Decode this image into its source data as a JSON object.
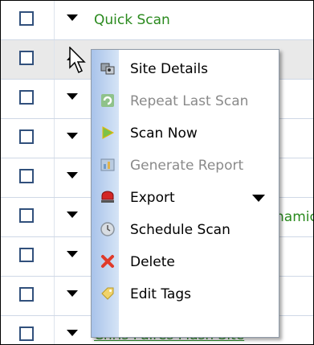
{
  "rows": [
    {
      "name": "Quick Scan"
    },
    {
      "name": ""
    },
    {
      "name": ""
    },
    {
      "name": ""
    },
    {
      "name": ""
    },
    {
      "name": "namic"
    },
    {
      "name": ""
    },
    {
      "name": ""
    },
    {
      "name": "Chris Paires Flash Site"
    }
  ],
  "menu": {
    "items": [
      {
        "label": "Site Details",
        "icon": "site-details-icon",
        "enabled": true
      },
      {
        "label": "Repeat Last Scan",
        "icon": "repeat-icon",
        "enabled": false
      },
      {
        "label": "Scan Now",
        "icon": "play-icon",
        "enabled": true
      },
      {
        "label": "Generate Report",
        "icon": "report-icon",
        "enabled": false
      },
      {
        "label": "Export",
        "icon": "export-icon",
        "enabled": true,
        "submenu": true
      },
      {
        "label": "Schedule Scan",
        "icon": "clock-icon",
        "enabled": true
      },
      {
        "label": "Delete",
        "icon": "delete-icon",
        "enabled": true
      },
      {
        "label": "Edit Tags",
        "icon": "tags-icon",
        "enabled": true
      }
    ]
  },
  "colors": {
    "link_green": "#2a8a1e",
    "checkbox_border": "#31507c",
    "menu_gutter": "#a8c3ea"
  }
}
